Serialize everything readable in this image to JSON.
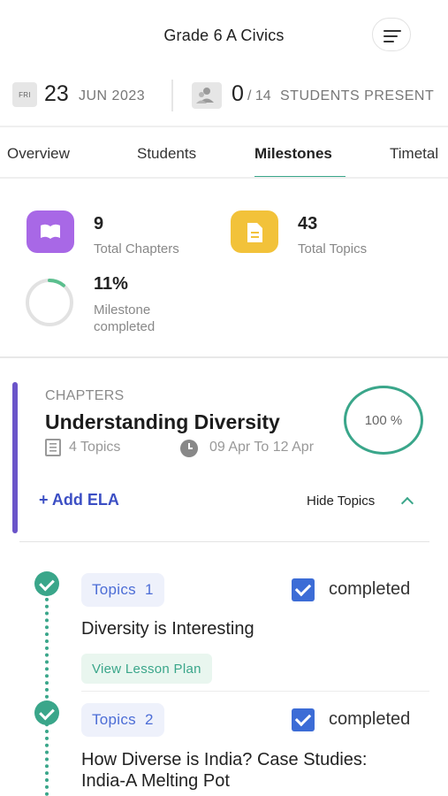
{
  "header": {
    "title": "Grade 6 A Civics",
    "menu_icon": "menu-lines-icon"
  },
  "info": {
    "day": "FRI",
    "date_day": "23",
    "date_month_year": "JUN 2023",
    "students_present": "0",
    "students_total": "/ 14",
    "students_label": "STUDENTS PRESENT"
  },
  "tabs": [
    {
      "label": "Overview"
    },
    {
      "label": "Students"
    },
    {
      "label": "Milestones",
      "active": true
    },
    {
      "label": "Timetal"
    }
  ],
  "stats": {
    "chapters": {
      "value": "9",
      "label": "Total Chapters",
      "color": "#a868e6"
    },
    "topics": {
      "value": "43",
      "label": "Total Topics",
      "color": "#f2c23a"
    },
    "milestone": {
      "value": "11%",
      "label_line1": "Milestone",
      "label_line2": "completed",
      "progress": 0.11
    }
  },
  "chapter": {
    "caption": "CHAPTERS",
    "title": "Understanding Diversity",
    "topics_count": "4 Topics",
    "date_range": "09 Apr  To  12 Apr",
    "percent": "100 %",
    "add_ela": "+ Add ELA",
    "hide_topics": "Hide Topics",
    "accent": "#6a54c9"
  },
  "topics": [
    {
      "chip_label": "Topics",
      "chip_num": "1",
      "status": "completed",
      "title": "Diversity is Interesting",
      "lesson_plan": "View Lesson Plan"
    },
    {
      "chip_label": "Topics",
      "chip_num": "2",
      "status": "completed",
      "title_line1": "How Diverse is India? Case Studies:",
      "title_line2": "India-A Melting Pot"
    }
  ],
  "colors": {
    "green": "#3aa68a",
    "blue": "#3c6cd6",
    "indigo": "#3c4fc4"
  }
}
